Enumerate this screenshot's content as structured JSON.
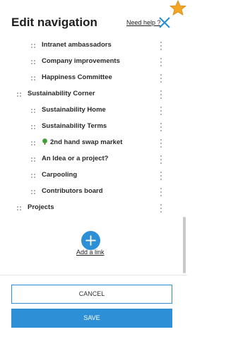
{
  "header": {
    "title": "Edit navigation",
    "help_link": "Need help ?",
    "close_icon": "close-icon",
    "star_icon": "star-icon"
  },
  "nav_items": [
    {
      "label": "Intranet ambassadors",
      "level": 2
    },
    {
      "label": "Company improvements",
      "level": 2
    },
    {
      "label": "Happiness Committee",
      "level": 2
    },
    {
      "label": "Sustainability Corner",
      "level": 1
    },
    {
      "label": "Sustainability Home",
      "level": 2
    },
    {
      "label": "Sustainability Terms",
      "level": 2
    },
    {
      "label": "2nd hand swap market",
      "level": 2,
      "icon": "tree-icon"
    },
    {
      "label": "An Idea or a project?",
      "level": 2
    },
    {
      "label": "Carpooling",
      "level": 2
    },
    {
      "label": "Contributors board",
      "level": 2
    },
    {
      "label": "Projects",
      "level": 1
    }
  ],
  "add_link": {
    "label": "Add a link",
    "icon": "plus-icon"
  },
  "footer": {
    "cancel_label": "CANCEL",
    "save_label": "SAVE"
  },
  "colors": {
    "accent": "#2d8fd5",
    "star": "#f2a623",
    "text": "#2a2a2a"
  }
}
